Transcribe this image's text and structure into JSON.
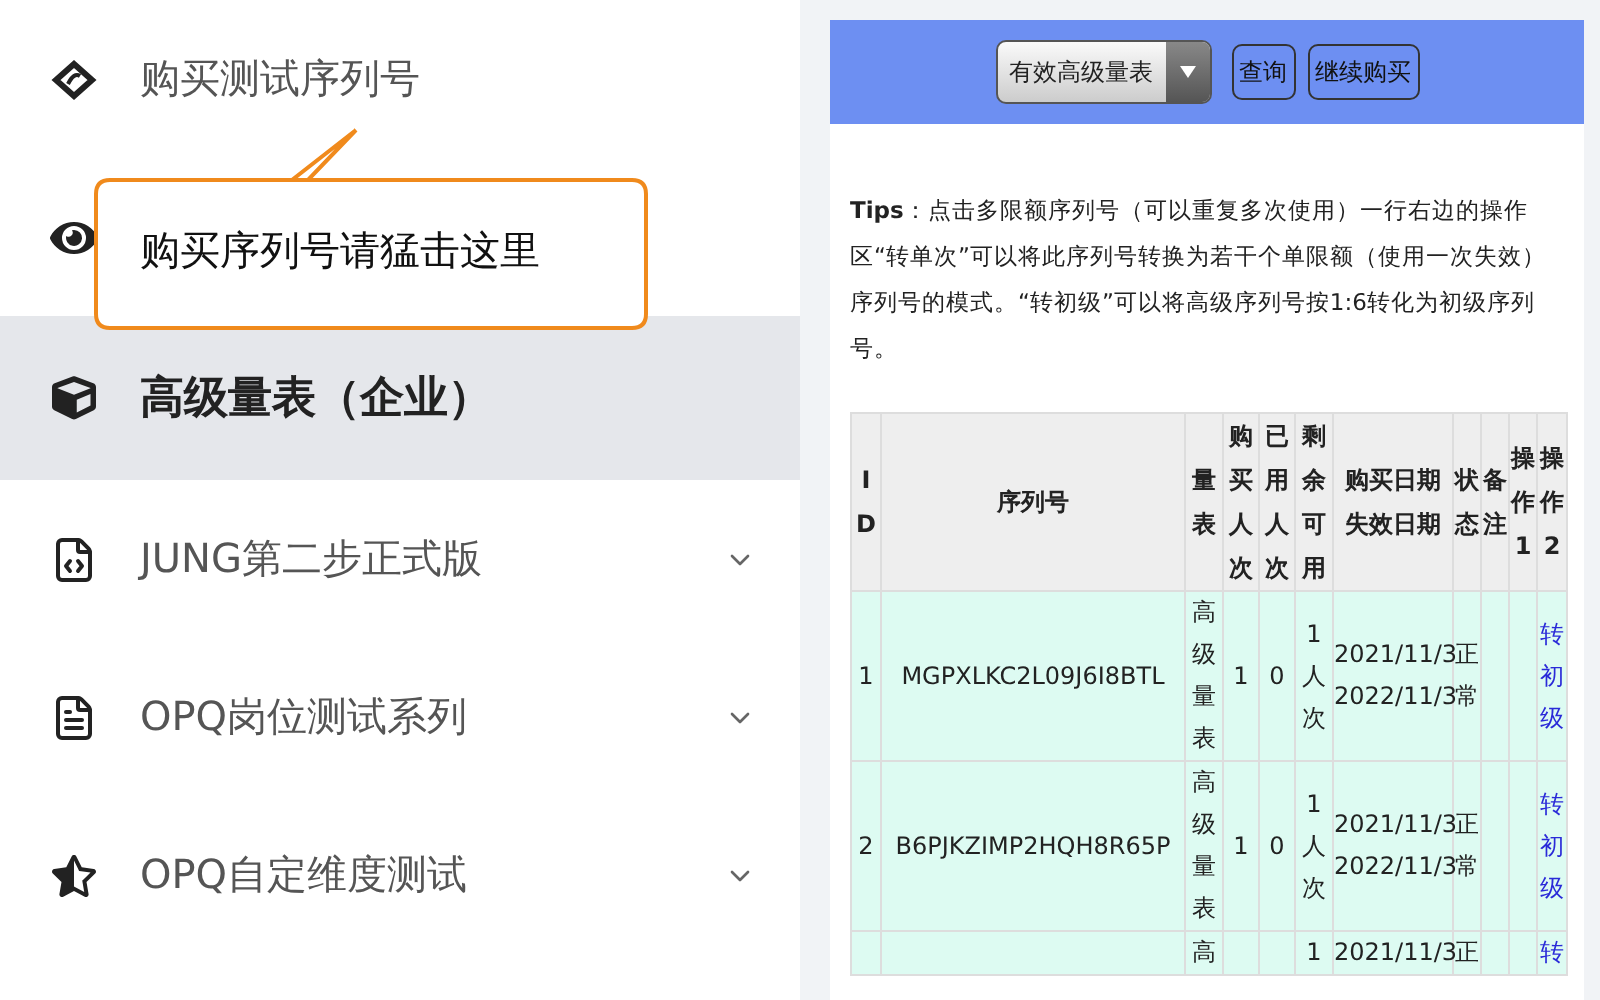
{
  "sidebar": {
    "items": [
      {
        "label": "购买测试序列号",
        "selected": false,
        "expandable": false
      },
      {
        "selected": false,
        "expandable": false
      },
      {
        "label": "高级量表（企业）",
        "selected": true,
        "expandable": false
      },
      {
        "label": "JUNG第二步正式版",
        "selected": false,
        "expandable": true
      },
      {
        "label": "OPQ岗位测试系列",
        "selected": false,
        "expandable": true
      },
      {
        "label": "OPQ自定维度测试",
        "selected": false,
        "expandable": true
      }
    ],
    "callout": {
      "text": "购买序列号请猛击这里"
    }
  },
  "toolbar": {
    "filter": {
      "value": "有效高级量表"
    },
    "buttons": [
      "查询",
      "继续购买"
    ]
  },
  "tips": "**Tips**：点击多限额序列号（可以重复多次使用）一行右边的操作区“转单次”可以将此序列号转换为若干个单限额（使用一次失效）序列号的模式。“转初级”可以将高级序列号按1:6转化为初级序列号。",
  "table": {
    "columns": [
      "ID",
      "序列号",
      "量表",
      "购买人次",
      "已用人次",
      "剩余可用",
      "购买日期失效日期",
      "状态",
      "备注",
      "操作1",
      "操作2"
    ],
    "rows": [
      {
        "id": "1",
        "serial": "MGPXLKC2L09J6I8BTL",
        "scale": "高级量表",
        "bought": "1",
        "used": "0",
        "remaining": "1人次",
        "purchase_date": "2021/11/3",
        "expiry_date": "2022/11/3",
        "status": "正常",
        "action2": "转初级"
      },
      {
        "id": "2",
        "serial": "B6PJKZIMP2HQH8R65P",
        "scale": "高级量表",
        "bought": "1",
        "used": "0",
        "remaining": "1人次",
        "purchase_date": "2021/11/3",
        "expiry_date": "2022/11/3",
        "status": "正常",
        "action2": "转初级"
      },
      {
        "scale": "高",
        "remaining": "1",
        "purchase_date": "2021/11/3",
        "status": "正",
        "action2": "转"
      }
    ]
  }
}
